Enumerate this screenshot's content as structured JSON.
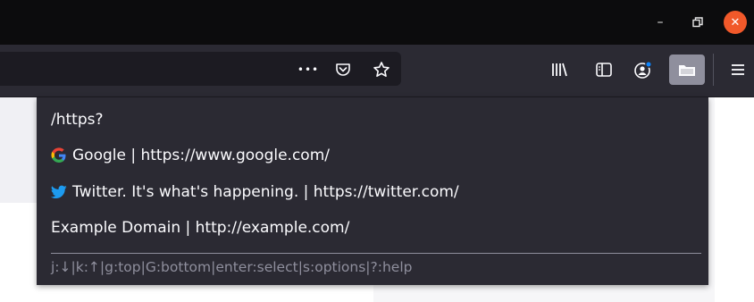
{
  "window": {
    "minimize_glyph": "–",
    "close_glyph": "✕"
  },
  "toolbar": {
    "page_actions_glyph": "•••",
    "icons": [
      "more-actions-icon",
      "pocket-icon",
      "bookmark-star-icon",
      "library-icon",
      "sidebar-icon",
      "account-icon",
      "extension-icon",
      "menu-icon"
    ],
    "active_extension_bg": "#8f8f9d"
  },
  "popup": {
    "query": "/https?",
    "items": [
      {
        "favicon": "google-icon",
        "label": "Google | https://www.google.com/"
      },
      {
        "favicon": "twitter-icon",
        "label": "Twitter. It's what's happening. | https://twitter.com/"
      },
      {
        "favicon": "",
        "label": "Example Domain | http://example.com/"
      }
    ],
    "help": "j:↓|k:↑|g:top|G:bottom|enter:select|s:options|?:help"
  },
  "colors": {
    "titlebar": "#0c0c0d",
    "toolbar": "#2b2a33",
    "close_button": "#f1592a",
    "twitter_blue": "#1d9bf0"
  }
}
